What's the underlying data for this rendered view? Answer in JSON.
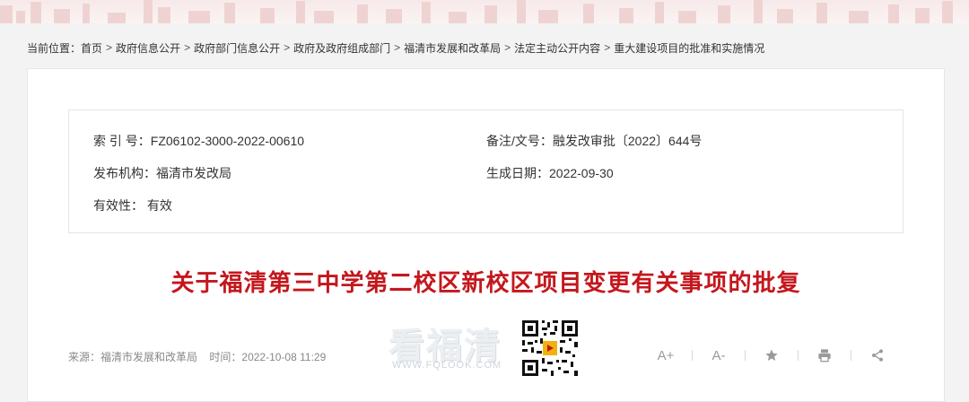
{
  "breadcrumb": {
    "prefix": "当前位置：",
    "items": [
      "首页",
      "政府信息公开",
      "政府部门信息公开",
      "政府及政府组成部门",
      "福清市发展和改革局",
      "法定主动公开内容",
      "重大建设项目的批准和实施情况"
    ],
    "separator": ">"
  },
  "meta": {
    "index_label": "索 引 号：",
    "index_value": "FZ06102-3000-2022-00610",
    "doc_no_label": "备注/文号：",
    "doc_no_value": "融发改审批〔2022〕644号",
    "publisher_label": "发布机构：",
    "publisher_value": "福清市发改局",
    "date_label": "生成日期：",
    "date_value": "2022-09-30",
    "validity_label": "有效性：",
    "validity_value": " 有效"
  },
  "article": {
    "title": "关于福清第三中学第二校区新校区项目变更有关事项的批复",
    "source_label": "来源：",
    "source_value": "福清市发展和改革局",
    "time_label": "时间：",
    "time_value": "2022-10-08 11:29"
  },
  "watermark": {
    "text": "看福清",
    "url": "WWW.FQLOOK.COM"
  },
  "tools": {
    "font_increase": "A+",
    "font_decrease": "A-",
    "favorite_icon": "star-icon",
    "print_icon": "printer-icon",
    "share_icon": "share-icon"
  },
  "colors": {
    "title_red": "#c4171d",
    "banner": "#f7e9e9",
    "page_bg": "#f3f3f3"
  }
}
